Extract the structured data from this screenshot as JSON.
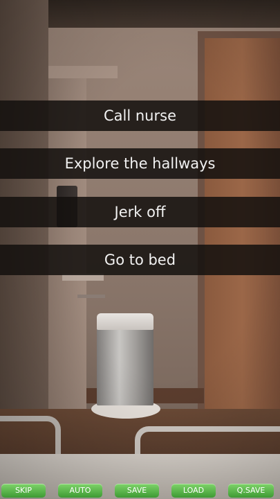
{
  "choices": [
    {
      "label": "Call nurse"
    },
    {
      "label": "Explore the hallways"
    },
    {
      "label": "Jerk off"
    },
    {
      "label": "Go to bed"
    }
  ],
  "quick_menu": {
    "skip": "SKIP",
    "auto": "AUTO",
    "save": "SAVE",
    "load": "LOAD",
    "qsave": "Q.SAVE"
  },
  "colors": {
    "choice_bg": "#14100e",
    "choice_text": "#f2f2f2",
    "button_green": "#3d9a33"
  }
}
